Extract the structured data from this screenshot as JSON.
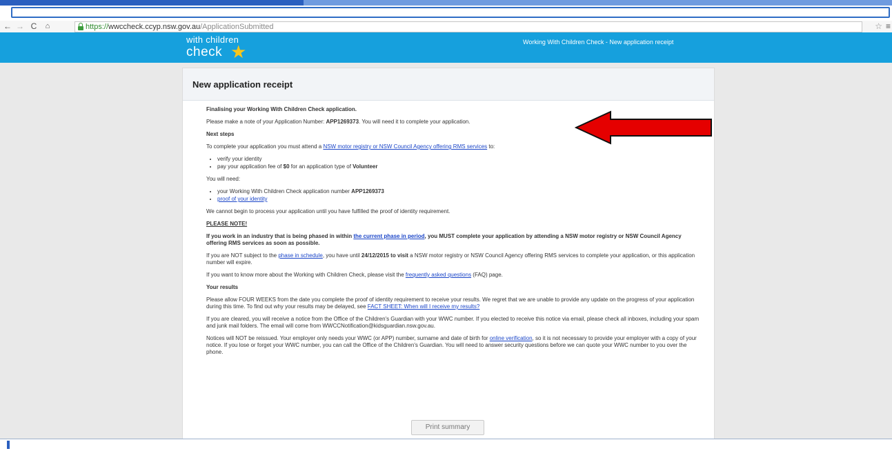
{
  "browser": {
    "url_secure": "https://",
    "url_host": "wwccheck.ccyp.nsw.gov.au",
    "url_path": "/ApplicationSubmitted"
  },
  "header": {
    "logo_line1": "with children",
    "logo_line2": "check",
    "title": "Working With Children Check - New application receipt"
  },
  "page": {
    "title": "New application receipt",
    "heading": "Finalising your Working With Children Check application.",
    "note_pre": "Please make a note of your Application Number: ",
    "app_number": "APP1269373",
    "note_post": ". You will need it to complete your application.",
    "next_steps_heading": "Next steps",
    "attend_pre": "To complete your application you must attend a ",
    "attend_link": "NSW motor registry or NSW Council Agency offering RMS services",
    "attend_post": " to:",
    "steps": {
      "verify": "verify your identity",
      "pay_pre": "pay your application fee of ",
      "fee": "$0",
      "pay_mid": " for an application type of ",
      "app_type": "Volunteer"
    },
    "need_label": "You will need:",
    "need": {
      "item1_pre": "your Working With Children Check application number ",
      "item1_num": "APP1269373",
      "item2_link": "proof of your identity"
    },
    "cannot_process": "We cannot begin to process your application until you have fulfilled the proof of identity requirement.",
    "please_note": "PLEASE NOTE!",
    "industry_pre": "If you work in an industry that is being phased in within ",
    "industry_link": "the current phase in period",
    "industry_post": ", you MUST complete your application by attending a NSW motor registry or NSW Council Agency offering RMS services as soon as possible.",
    "notsubject_pre": "If you are NOT subject to the ",
    "notsubject_link": "phase in schedule",
    "notsubject_mid": ", you have until ",
    "notsubject_date": "24/12/2015 to visit",
    "notsubject_post": " a NSW motor registry or NSW Council Agency offering RMS services to complete your application, or this application number will expire.",
    "faq_pre": "If you want to know more about the Working with Children Check, please visit the ",
    "faq_link": "frequently asked questions",
    "faq_post": " (FAQ) page.",
    "results_heading": "Your results",
    "results_pre": "Please allow FOUR WEEKS from the date you complete the proof of identity requirement to receive your results. We regret that we are unable to provide any update on the progress of your application during this time. To find out why your results may be delayed, see ",
    "results_link": "FACT SHEET: When will I receive my results?",
    "cleared": "If you are cleared, you will receive a notice from the Office of the Children's Guardian with your WWC number. If you elected to receive this notice via email, please check all inboxes, including your spam and junk mail folders. The email will come from WWCCNotification@kidsguardian.nsw.gov.au.",
    "notices_pre": "Notices will NOT be reissued. Your employer only needs your WWC (or APP) number, surname and date of birth for ",
    "notices_link": "online verification",
    "notices_post": ", so it is not necessary to provide your employer with a copy of your notice. If you lose or forget your WWC number, you can call the Office of the Children's Guardian. You will need to answer security questions before we can quote your WWC number to you over the phone.",
    "print_label": "Print summary"
  },
  "colors": {
    "header_blue": "#16a0dd",
    "link_blue": "#1a45c8",
    "arrow_red": "#e50000"
  },
  "icons": [
    "back-icon",
    "forward-icon",
    "reload-icon",
    "home-icon",
    "lock-icon",
    "star-icon",
    "menu-icon",
    "logo-star-icon",
    "red-arrow-icon"
  ]
}
